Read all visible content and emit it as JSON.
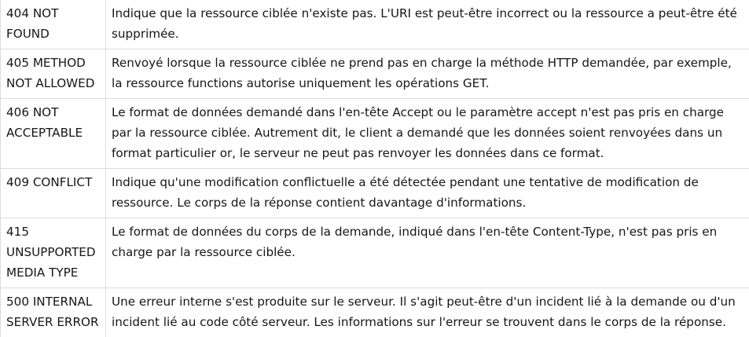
{
  "table": {
    "rows": [
      {
        "code": "404 NOT FOUND",
        "description": "Indique que la ressource ciblée n'existe pas. L'URI est peut-être incorrect ou la ressource a peut-être été supprimée."
      },
      {
        "code": "405 METHOD NOT ALLOWED",
        "description": "Renvoyé lorsque la ressource ciblée ne prend pas en charge la méthode HTTP demandée, par exemple, la ressource functions autorise uniquement les opérations GET."
      },
      {
        "code": "406 NOT ACCEPTABLE",
        "description": "Le format de données demandé dans l'en-tête Accept ou le paramètre accept n'est pas pris en charge par la ressource ciblée. Autrement dit, le client a demandé que les données soient renvoyées dans un format particulier or, le serveur ne peut pas renvoyer les données dans ce format."
      },
      {
        "code": "409 CONFLICT",
        "description": "Indique qu'une modification conflictuelle a été détectée pendant une tentative de modification de ressource. Le corps de la réponse contient davantage d'informations."
      },
      {
        "code": "415 UNSUPPORTED MEDIA TYPE",
        "description": "Le format de données du corps de la demande, indiqué dans l'en-tête Content-Type, n'est pas pris en charge par la ressource ciblée."
      },
      {
        "code": "500 INTERNAL SERVER ERROR",
        "description": "Une erreur interne s'est produite sur le serveur. Il s'agit peut-être d'un incident lié à la demande ou d'un incident lié au code côté serveur. Les informations sur l'erreur se trouvent dans le corps de la réponse."
      }
    ]
  }
}
